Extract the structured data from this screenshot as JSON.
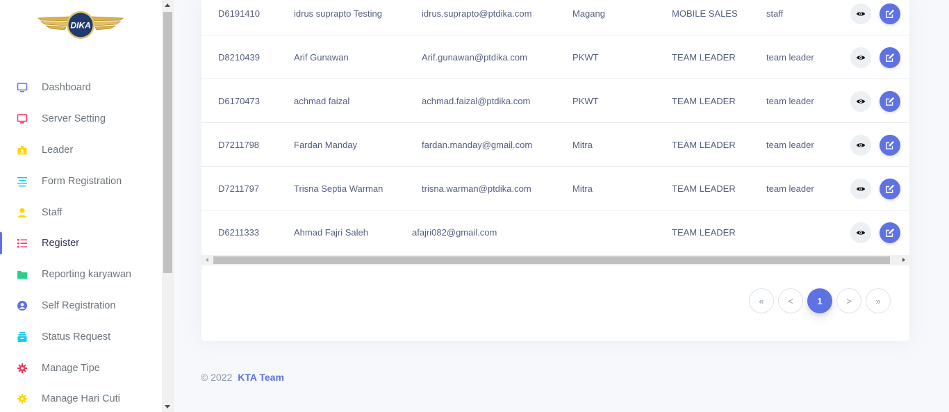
{
  "logo": {
    "text": "DIKA"
  },
  "sidebar": {
    "items": [
      {
        "label": "Dashboard",
        "icon": "monitor-icon",
        "color": "#5e72e4",
        "active": false
      },
      {
        "label": "Server Setting",
        "icon": "monitor-icon",
        "color": "#f5365c",
        "active": false
      },
      {
        "label": "Leader",
        "icon": "badge-icon",
        "color": "#ffd600",
        "active": false
      },
      {
        "label": "Form Registration",
        "icon": "align-left-icon",
        "color": "#11cdef",
        "active": false
      },
      {
        "label": "Staff",
        "icon": "user-icon",
        "color": "#ffd600",
        "active": false
      },
      {
        "label": "Register",
        "icon": "list-icon",
        "color": "#f5365c",
        "active": true
      },
      {
        "label": "Reporting karyawan",
        "icon": "folder-icon",
        "color": "#2dce89",
        "active": false
      },
      {
        "label": "Self Registration",
        "icon": "user-circle-icon",
        "color": "#5e72e4",
        "active": false
      },
      {
        "label": "Status Request",
        "icon": "archive-icon",
        "color": "#11cdef",
        "active": false
      },
      {
        "label": "Manage Tipe",
        "icon": "gear-icon",
        "color": "#f5365c",
        "active": false
      },
      {
        "label": "Manage Hari Cuti",
        "icon": "gear-icon",
        "color": "#ffd600",
        "active": false
      }
    ]
  },
  "table": {
    "rows": [
      {
        "id": "D6191410",
        "name": "idrus suprapto Testing",
        "email": "idrus.suprapto@ptdika.com",
        "type": "Magang",
        "position": "MOBILE SALES",
        "role": "staff"
      },
      {
        "id": "D8210439",
        "name": "Arif Gunawan",
        "email": "Arif.gunawan@ptdika.com",
        "type": "PKWT",
        "position": "TEAM LEADER",
        "role": "team leader"
      },
      {
        "id": "D6170473",
        "name": "achmad faizal",
        "email": "achmad.faizal@ptdika.com",
        "type": "PKWT",
        "position": "TEAM LEADER",
        "role": "team leader"
      },
      {
        "id": "D7211798",
        "name": "Fardan Manday",
        "email": "fardan.manday@gmail.com",
        "type": "Mitra",
        "position": "TEAM LEADER",
        "role": "team leader"
      },
      {
        "id": "D7211797",
        "name": "Trisna Septia Warman",
        "email": "trisna.warman@ptdika.com",
        "type": "Mitra",
        "position": "TEAM LEADER",
        "role": "team leader"
      },
      {
        "id": "D6211333",
        "name": "Ahmad Fajri Saleh",
        "email": "afajri082@gmail.com",
        "type": "",
        "position": "TEAM LEADER",
        "role": ""
      }
    ]
  },
  "pagination": {
    "first": "«",
    "prev": "<",
    "current": "1",
    "next": ">",
    "last": "»"
  },
  "footer": {
    "copyright": "© 2022",
    "brand": "KTA Team"
  },
  "colors": {
    "primary": "#5e72e4",
    "danger": "#f5365c",
    "warning": "#ffd600",
    "info": "#11cdef",
    "success": "#2dce89"
  }
}
